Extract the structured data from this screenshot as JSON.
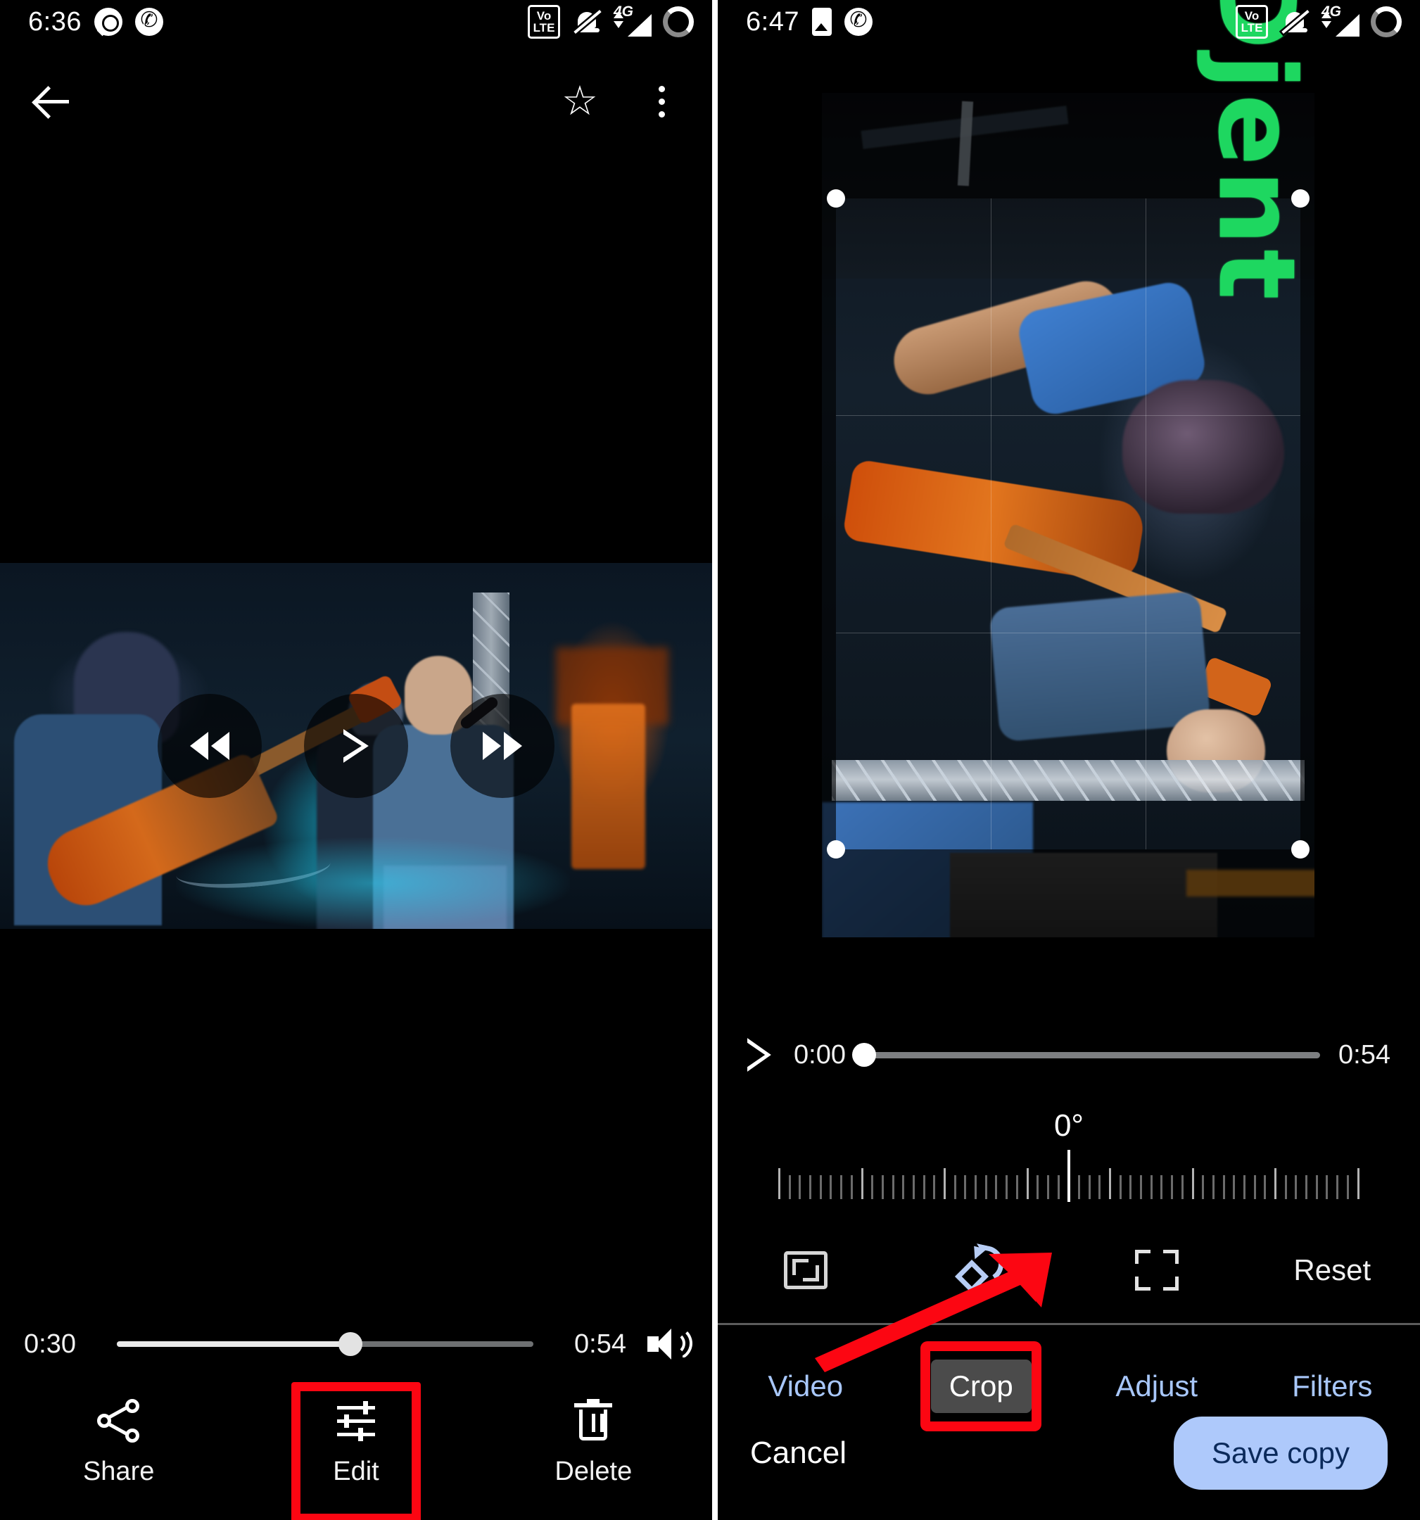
{
  "left_panel": {
    "statusbar": {
      "time": "6:36",
      "icons_left": [
        "whatsapp-icon",
        "phone-icon"
      ],
      "icons_right": [
        "volte-icon",
        "notifications-muted-icon",
        "signal-4g-icon",
        "battery-icon"
      ],
      "volte_top": "Vo",
      "volte_bottom": "LTE",
      "network": "4G"
    },
    "toolbar": {
      "back": "back-arrow-icon",
      "favorite": "☆",
      "overflow": "more-options-icon"
    },
    "player": {
      "rewind": "rewind-icon",
      "play": "play-icon",
      "forward": "fast-forward-icon",
      "current_time": "0:30",
      "total_time": "0:54",
      "progress_percent": 56,
      "volume": "volume-on-icon"
    },
    "actions": [
      {
        "label": "Share",
        "icon": "share-icon",
        "highlighted": false
      },
      {
        "label": "Edit",
        "icon": "tune-icon",
        "highlighted": true
      },
      {
        "label": "Delete",
        "icon": "trash-icon",
        "highlighted": false
      }
    ]
  },
  "right_panel": {
    "statusbar": {
      "time": "6:47",
      "icons_left": [
        "photo-icon",
        "phone-icon"
      ],
      "icons_right": [
        "volte-icon",
        "notifications-muted-icon",
        "signal-4g-icon",
        "battery-icon"
      ],
      "volte_top": "Vo",
      "volte_bottom": "LTE",
      "network": "4G"
    },
    "crop": {
      "overlay_text": "#Djent",
      "overlay_color": "#1ed760",
      "handles": [
        "top-left",
        "top-right",
        "bottom-left",
        "bottom-right"
      ],
      "grid_visible": true
    },
    "player": {
      "play": "play-icon",
      "current_time": "0:00",
      "total_time": "0:54",
      "progress_percent": 0
    },
    "rotation": {
      "value": "0°",
      "tick_count": 57
    },
    "tools": [
      {
        "name": "aspect-ratio",
        "label": "",
        "icon": "aspect-ratio-icon",
        "active": false
      },
      {
        "name": "rotate",
        "label": "",
        "icon": "rotate-icon",
        "active": true
      },
      {
        "name": "auto-straighten",
        "label": "",
        "icon": "crop-frame-icon",
        "active": false
      },
      {
        "name": "reset",
        "label": "Reset",
        "icon": "",
        "active": false
      }
    ],
    "tabs": [
      {
        "label": "Video",
        "active": false,
        "highlighted": false
      },
      {
        "label": "Crop",
        "active": true,
        "highlighted": true
      },
      {
        "label": "Adjust",
        "active": false,
        "highlighted": false
      },
      {
        "label": "Filters",
        "active": false,
        "highlighted": false
      }
    ],
    "footer": {
      "cancel": "Cancel",
      "save": "Save copy",
      "save_bg": "#aec9fb",
      "save_fg": "#0b2a5b"
    }
  },
  "annotations": {
    "highlight_color": "#fc0612",
    "arrow": "red-arrow-pointing-to-rotate-tool"
  }
}
